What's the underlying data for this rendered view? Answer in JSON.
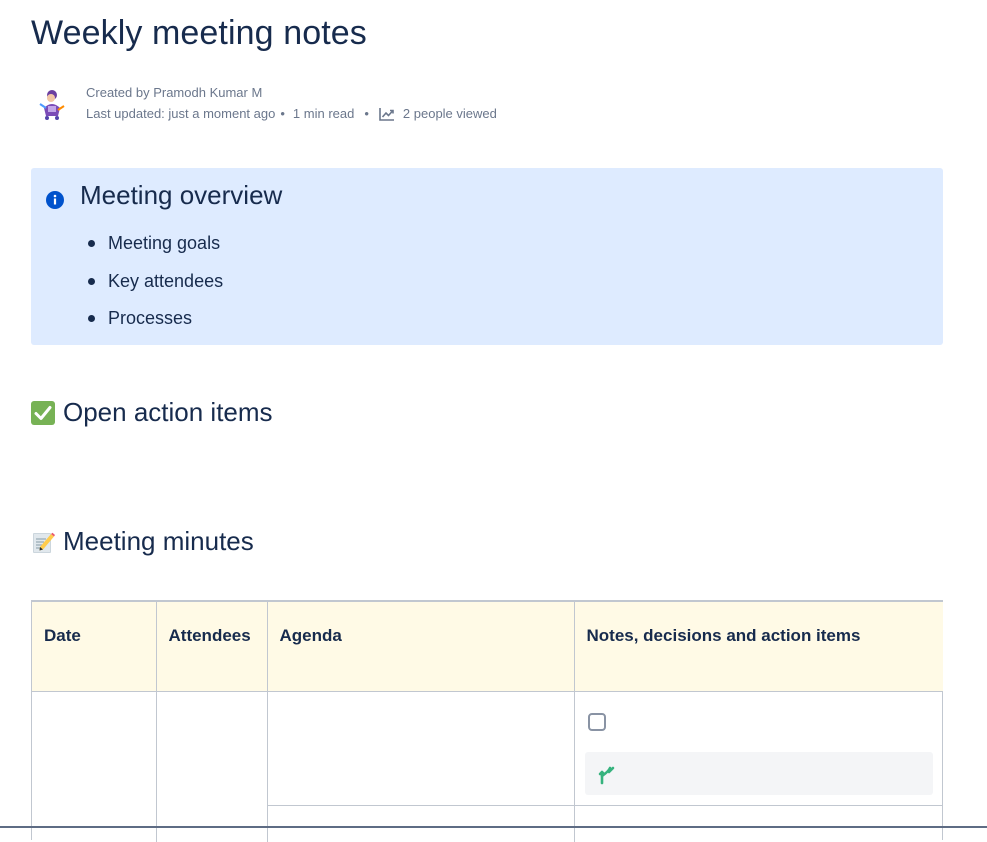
{
  "page": {
    "title": "Weekly meeting notes"
  },
  "byline": {
    "created_by": "Created by Pramodh Kumar M",
    "last_updated": "Last updated: just a moment ago",
    "read_time": "1 min read",
    "views": "2 people viewed",
    "views_icon": "analytics-chart-icon",
    "avatar_icon": "avatar-character-icon"
  },
  "overview_panel": {
    "icon": "info-icon",
    "title": "Meeting overview",
    "items": [
      "Meeting goals",
      "Key attendees",
      "Processes"
    ],
    "background": "#deebff",
    "icon_color": "#0052cc"
  },
  "sections": {
    "action_items": {
      "emoji": "check-mark-button-icon",
      "title": "Open action items"
    },
    "minutes": {
      "emoji": "memo-icon",
      "title": "Meeting minutes"
    }
  },
  "table": {
    "headers": [
      "Date",
      "Attendees",
      "Agenda",
      "Notes, decisions and action items"
    ],
    "header_background": "#fffae6",
    "decision_icon": "decision-icon",
    "decision_icon_color": "#36b37e"
  }
}
